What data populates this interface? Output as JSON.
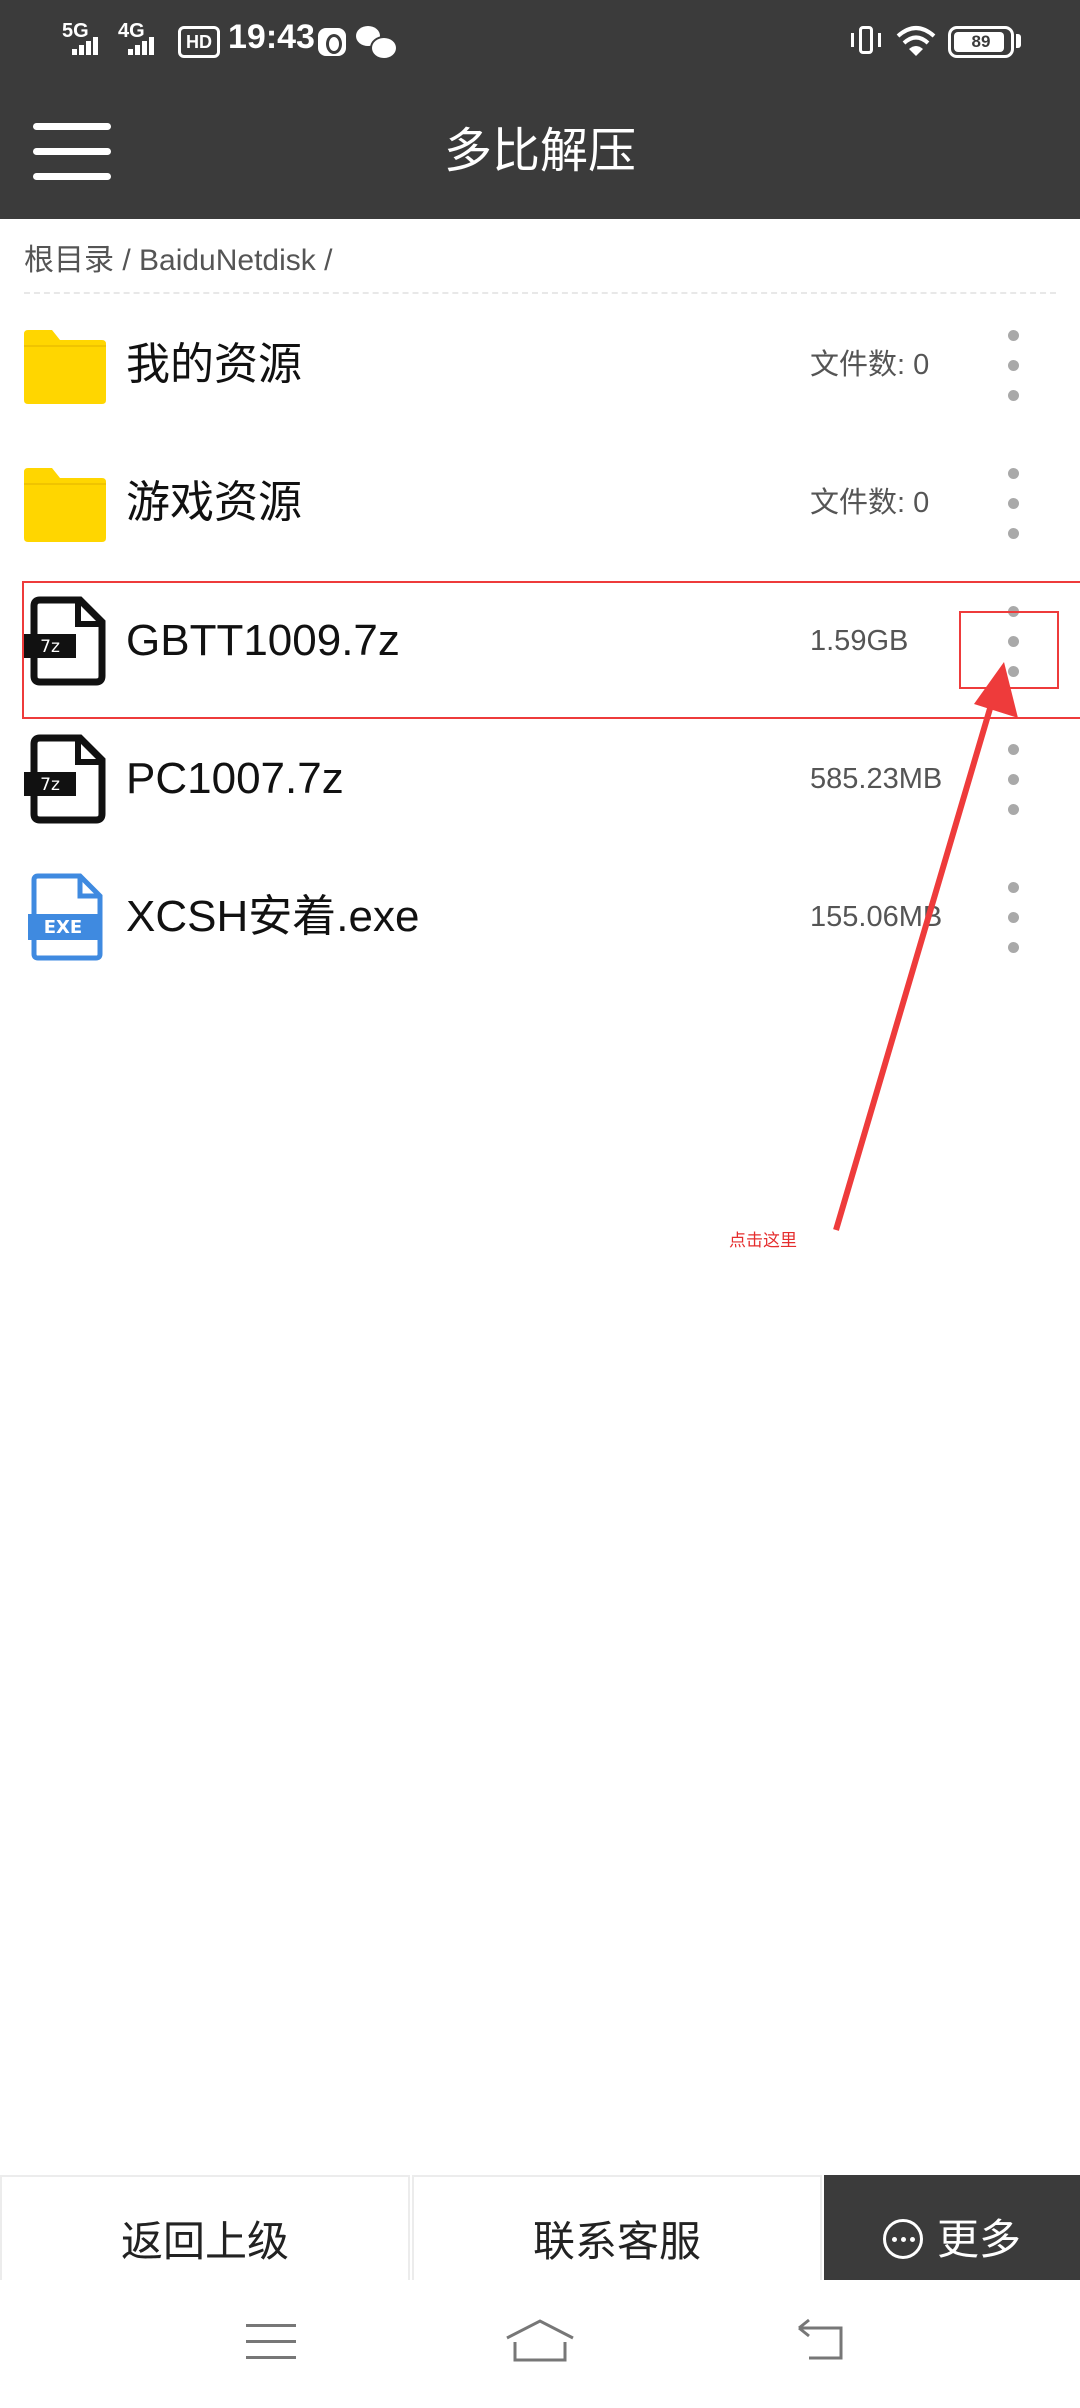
{
  "status_bar": {
    "net1": "5G",
    "net2": "4G",
    "hd": "HD",
    "time": "19:43",
    "battery": "89"
  },
  "app_bar": {
    "title": "多比解压"
  },
  "breadcrumb": {
    "path": "根目录 / BaiduNetdisk /"
  },
  "files": [
    {
      "name": "我的资源",
      "meta": "文件数: 0",
      "icon": "folder-icon"
    },
    {
      "name": "游戏资源",
      "meta": "文件数: 0",
      "icon": "folder-icon"
    },
    {
      "name": "GBTT1009.7z",
      "meta": "1.59GB",
      "icon": "7z-file-icon",
      "icon_text": "7z"
    },
    {
      "name": "PC1007.7z",
      "meta": "585.23MB",
      "icon": "7z-file-icon",
      "icon_text": "7z"
    },
    {
      "name": "XCSH安着.exe",
      "meta": "155.06MB",
      "icon": "exe-file-icon",
      "icon_text": "EXE"
    }
  ],
  "annotation": {
    "text": "点击这里",
    "color": "#ee3b3b"
  },
  "bottom_bar": {
    "back": "返回上级",
    "contact": "联系客服",
    "more": "更多"
  },
  "colors": {
    "header": "#3b3b3b",
    "folder": "#ffd600",
    "exe_accent": "#3f8ae0"
  }
}
